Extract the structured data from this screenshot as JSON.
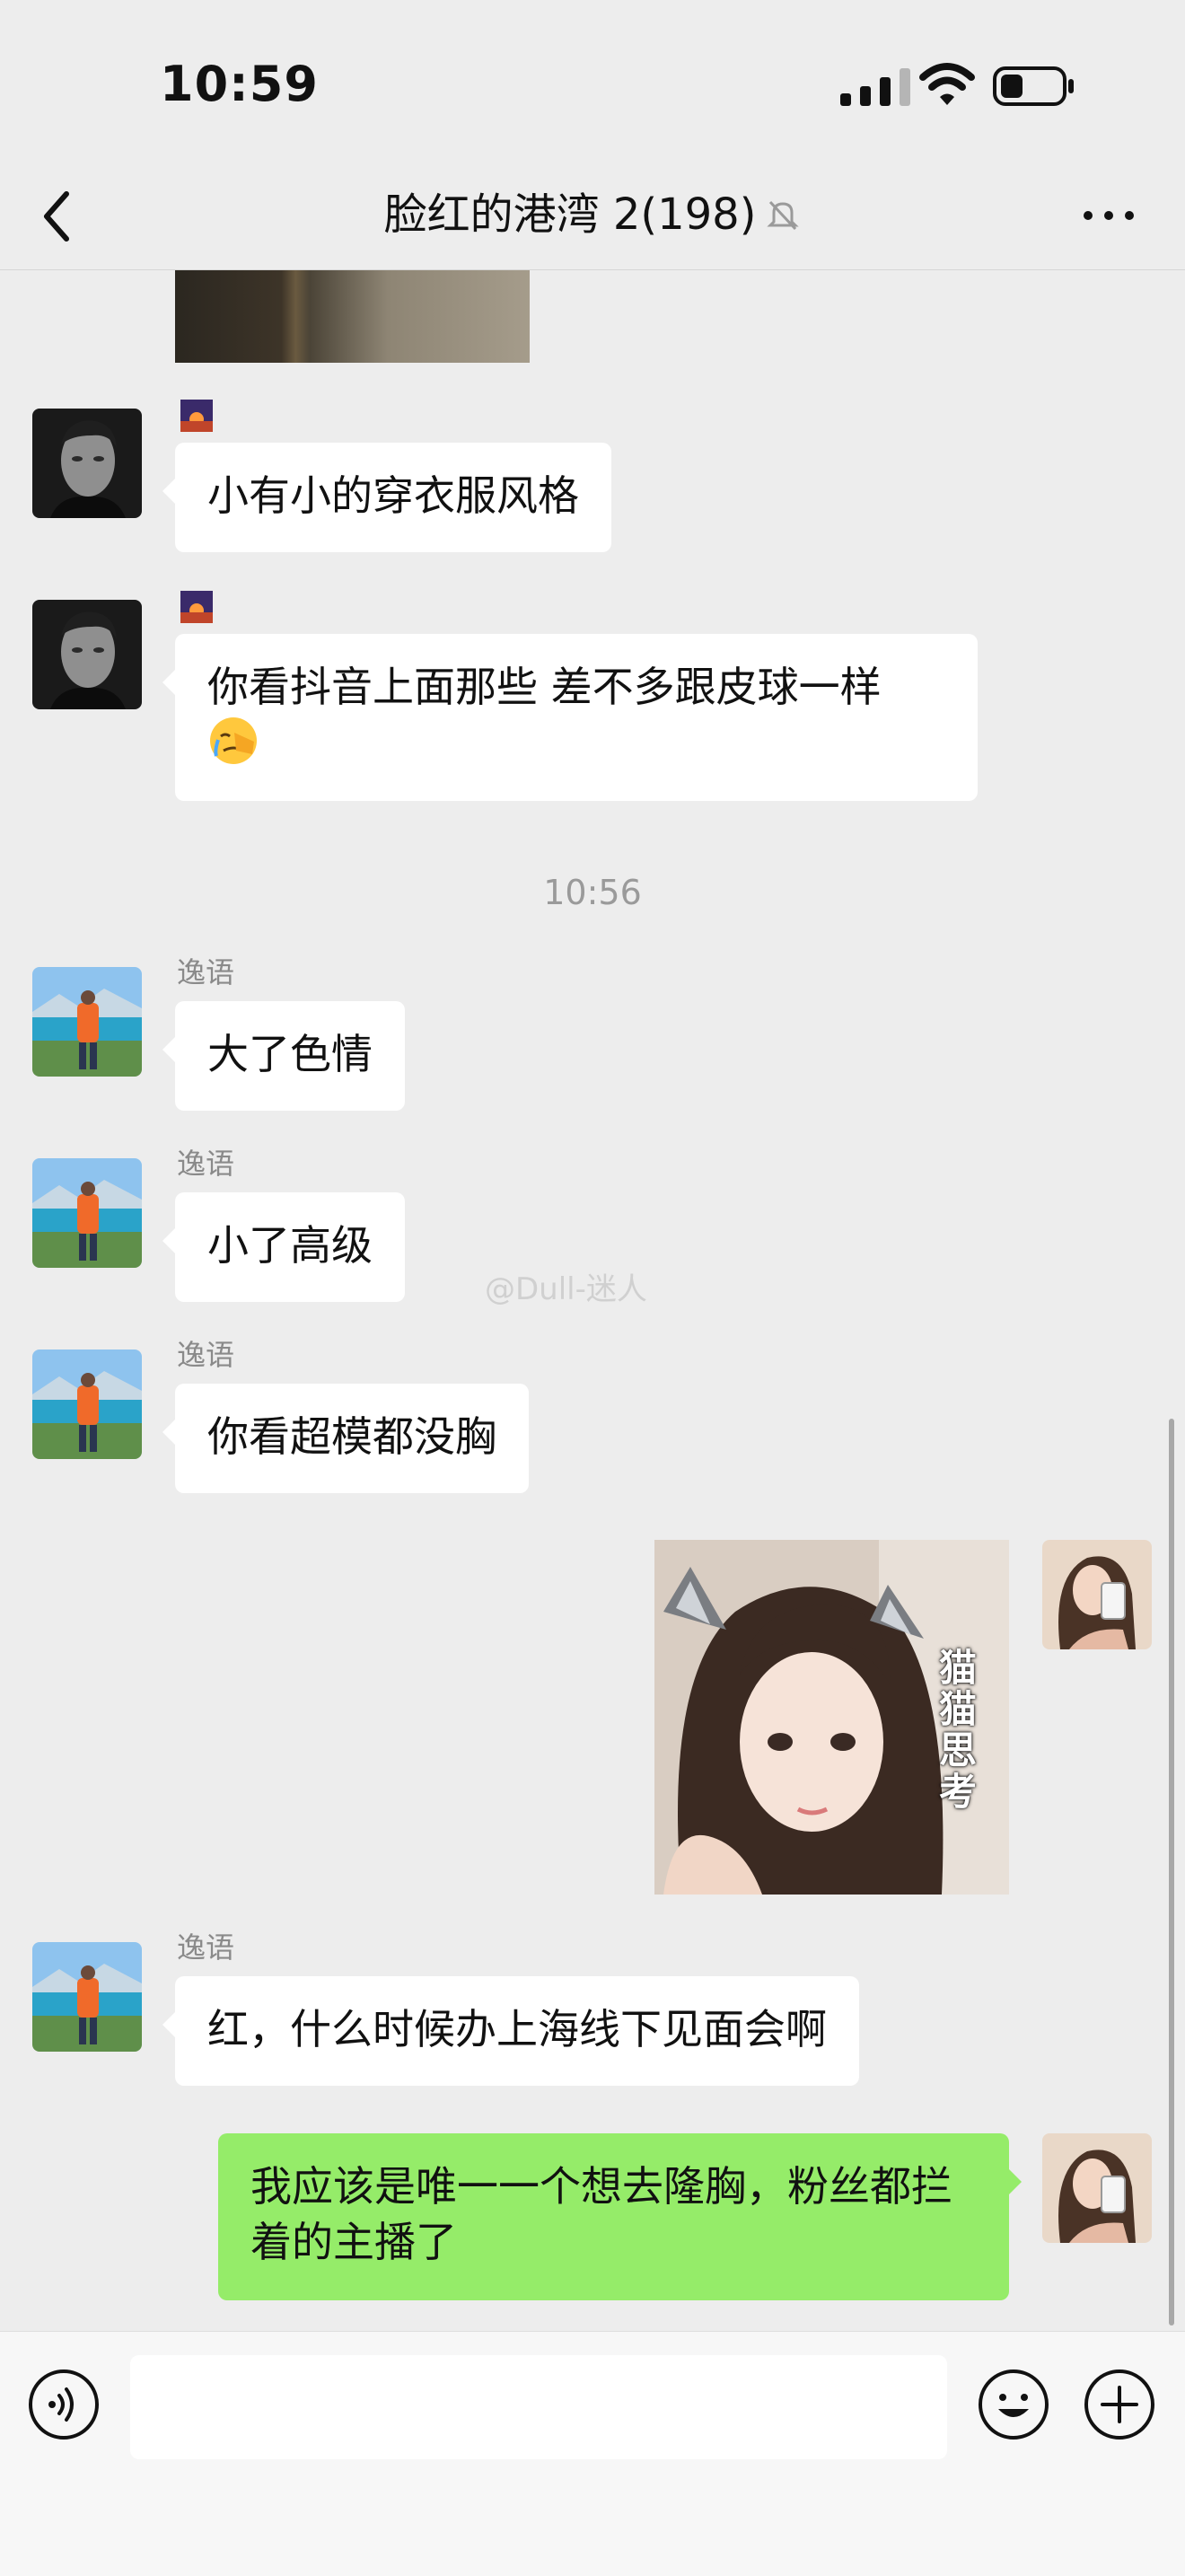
{
  "status_bar": {
    "time": "10:59"
  },
  "nav": {
    "title": "脸红的港湾 2(198)"
  },
  "timestamp": "10:56",
  "messages": [
    {
      "text": "小有小的穿衣服风格"
    },
    {
      "text": "你看抖音上面那些 差不多跟皮球一样"
    },
    {
      "sender": "逸语",
      "text": "大了色情"
    },
    {
      "sender": "逸语",
      "text": "小了高级"
    },
    {
      "sender": "逸语",
      "text": "你看超模都没胸"
    },
    {
      "sticker_text": "猫猫思考"
    },
    {
      "sender": "逸语",
      "text": "红，什么时候办上海线下见面会啊"
    },
    {
      "text": "我应该是唯一一个想去隆胸，粉丝都拦着的主播了"
    }
  ],
  "watermark": "@Dull-迷人",
  "colors": {
    "background": "#ededed",
    "my_bubble": "#95ec69",
    "other_bubble": "#ffffff"
  },
  "icons": [
    "back-icon",
    "mute-bell-icon",
    "more-icon",
    "voice-icon",
    "emoji-icon",
    "plus-icon"
  ]
}
